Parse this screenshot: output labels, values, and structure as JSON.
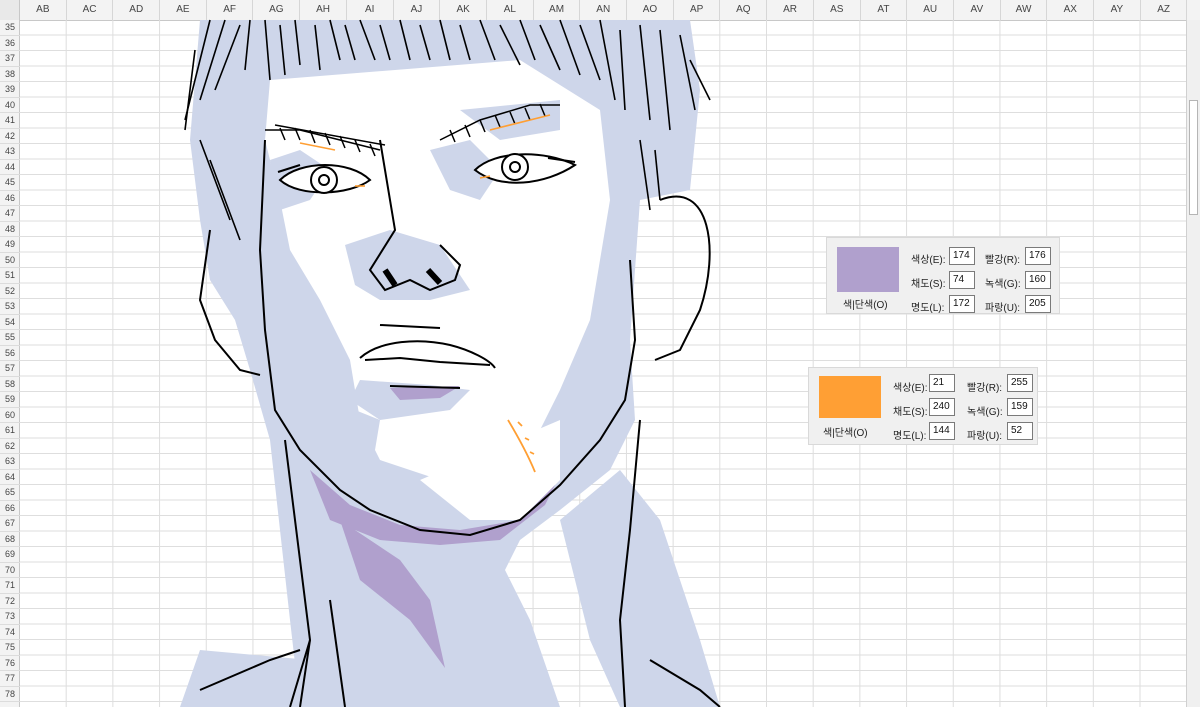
{
  "columns": [
    "AB",
    "AC",
    "AD",
    "AE",
    "AF",
    "AG",
    "AH",
    "AI",
    "AJ",
    "AK",
    "AL",
    "AM",
    "AN",
    "AO",
    "AP",
    "AQ",
    "AR",
    "AS",
    "AT",
    "AU",
    "AV",
    "AW",
    "AX",
    "AY",
    "AZ"
  ],
  "rows": [
    "35",
    "36",
    "37",
    "38",
    "39",
    "40",
    "41",
    "42",
    "43",
    "44",
    "45",
    "46",
    "47",
    "48",
    "49",
    "50",
    "51",
    "52",
    "53",
    "54",
    "55",
    "56",
    "57",
    "58",
    "59",
    "60",
    "61",
    "62",
    "63",
    "64",
    "65",
    "66",
    "67",
    "68",
    "69",
    "70",
    "71",
    "72",
    "73",
    "74",
    "75",
    "76",
    "77",
    "78"
  ],
  "colors": {
    "skin_shade": "#ced6ea",
    "purple_shade": "#b0a0cd",
    "orange_accent": "#ff9f34",
    "line": "#000000"
  },
  "color_panels": [
    {
      "swatch_color": "#b0a0cd",
      "label": "색|단색(O)",
      "hue_label": "색상(E):",
      "hue": "174",
      "sat_label": "채도(S):",
      "sat": "74",
      "lum_label": "명도(L):",
      "lum": "172",
      "red_label": "빨강(R):",
      "red": "176",
      "green_label": "녹색(G):",
      "green": "160",
      "blue_label": "파랑(U):",
      "blue": "205"
    },
    {
      "swatch_color": "#ff9f34",
      "label": "색|단색(O)",
      "hue_label": "색상(E):",
      "hue": "21",
      "sat_label": "채도(S):",
      "sat": "240",
      "lum_label": "명도(L):",
      "lum": "144",
      "red_label": "빨강(R):",
      "red": "255",
      "green_label": "녹색(G):",
      "green": "159",
      "blue_label": "파랑(U):",
      "blue": "52"
    }
  ]
}
